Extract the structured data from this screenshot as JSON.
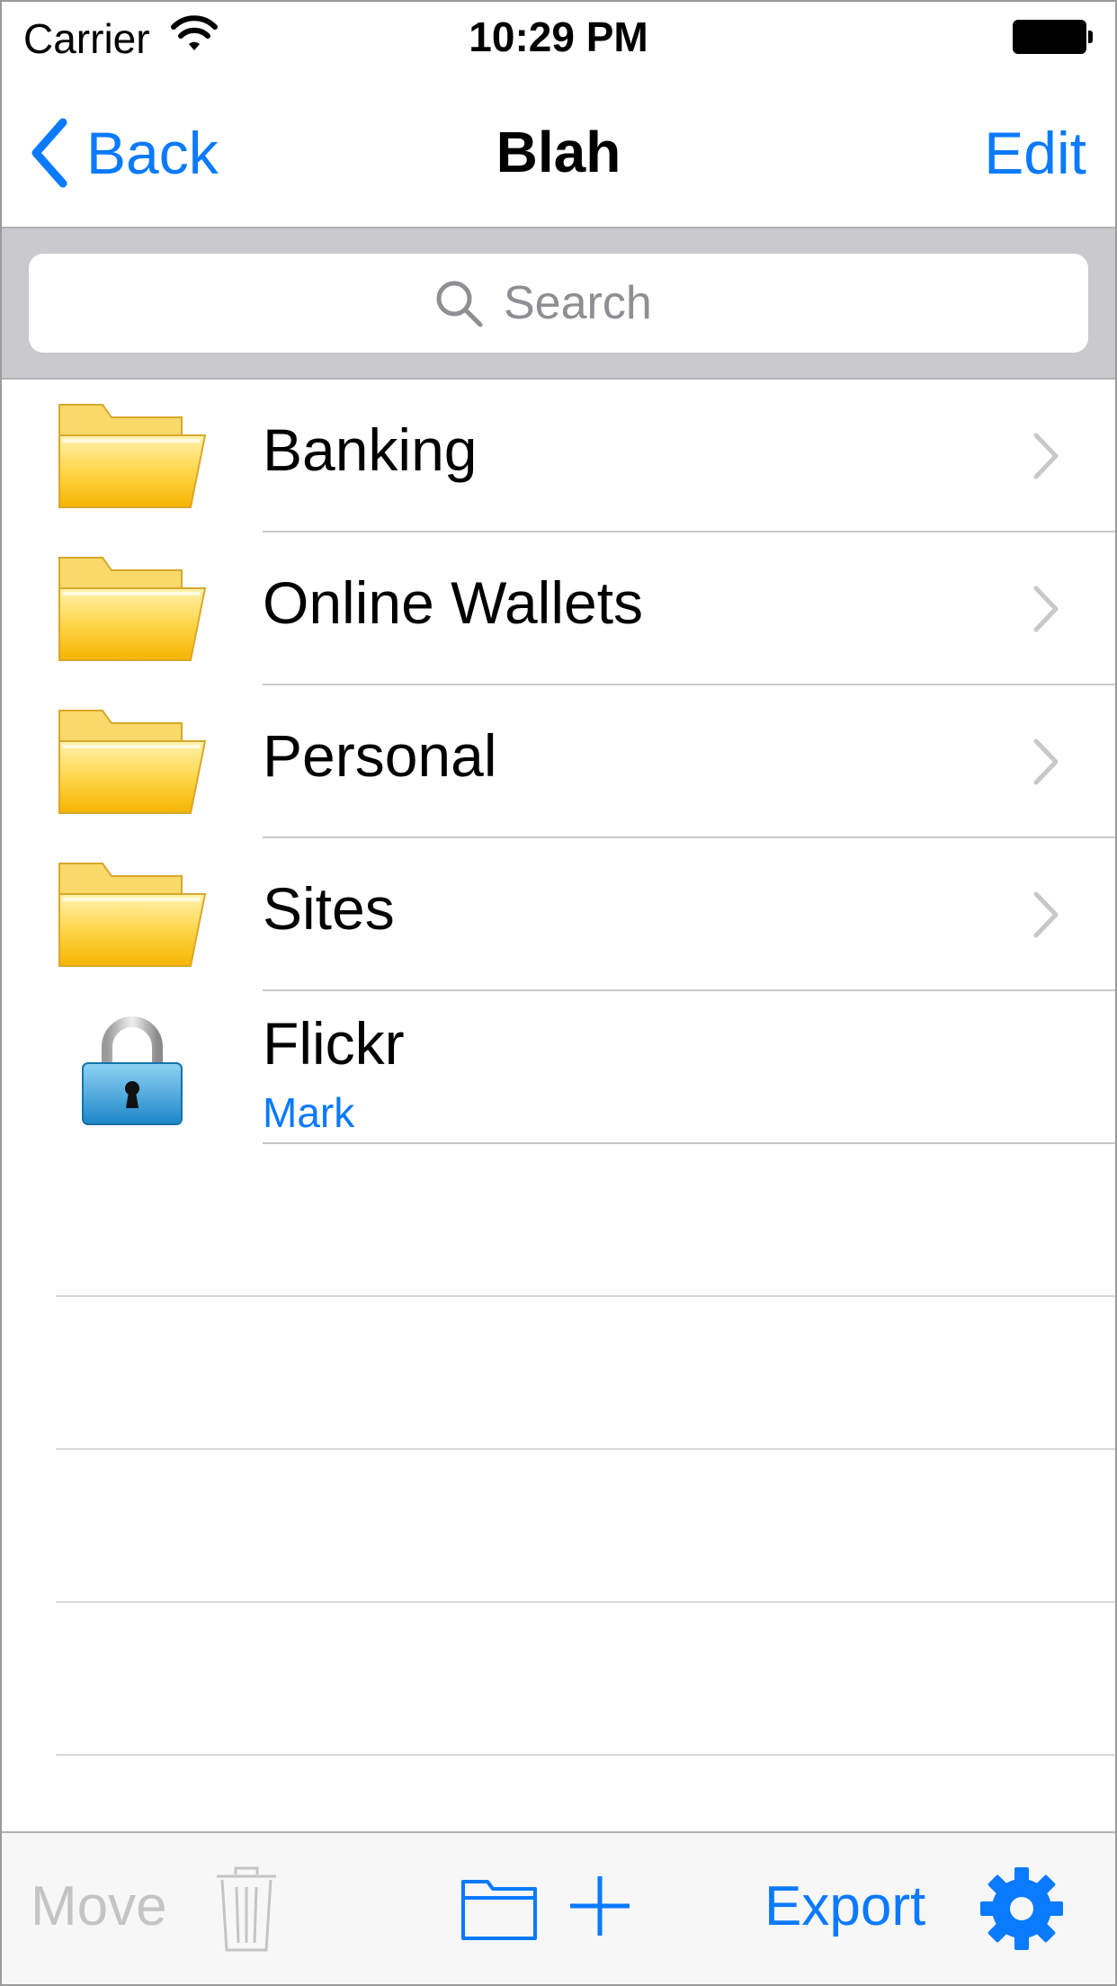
{
  "status_bar": {
    "carrier": "Carrier",
    "time": "10:29 PM"
  },
  "nav": {
    "back_label": "Back",
    "title": "Blah",
    "edit_label": "Edit"
  },
  "search": {
    "placeholder": "Search"
  },
  "items": [
    {
      "title": "Banking",
      "type": "folder",
      "icon": "folder-icon"
    },
    {
      "title": "Online Wallets",
      "type": "folder",
      "icon": "folder-icon"
    },
    {
      "title": "Personal",
      "type": "folder",
      "icon": "folder-icon"
    },
    {
      "title": "Sites",
      "type": "folder",
      "icon": "folder-icon"
    },
    {
      "title": "Flickr",
      "subtitle": "Mark",
      "type": "entry",
      "icon": "lock-icon"
    }
  ],
  "toolbar": {
    "move_label": "Move",
    "export_label": "Export",
    "icons": [
      "trash-icon",
      "folder-icon",
      "plus-icon",
      "gear-icon"
    ]
  },
  "colors": {
    "accent": "#0a7aff",
    "disabled": "#c4c4c4",
    "search_bar_bg": "#c9c9ce",
    "folder": "#f9c32f",
    "lock": "#3aa6dd"
  }
}
